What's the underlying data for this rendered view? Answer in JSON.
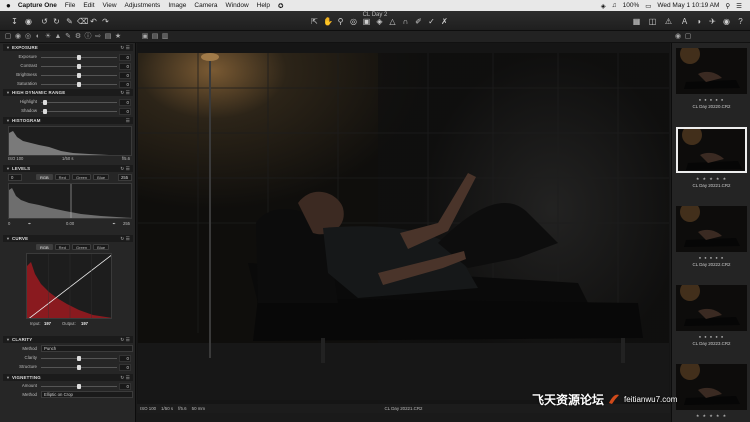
{
  "menubar": {
    "apple": "",
    "items": [
      "Capture One",
      "File",
      "Edit",
      "View",
      "Adjustments",
      "Image",
      "Camera",
      "Window",
      "Help"
    ],
    "battery": "100%",
    "clock": "Wed May 1  10:19 AM"
  },
  "toolbar": {
    "title": "CL Day 2"
  },
  "left_panel": {
    "exposure": {
      "header": "EXPOSURE",
      "rows": [
        {
          "label": "Exposure",
          "value": "0",
          "pos": 0.5
        },
        {
          "label": "Contrast",
          "value": "0",
          "pos": 0.5
        },
        {
          "label": "Brightness",
          "value": "0",
          "pos": 0.5
        },
        {
          "label": "Saturation",
          "value": "0",
          "pos": 0.5
        }
      ]
    },
    "hdr": {
      "header": "HIGH DYNAMIC RANGE",
      "rows": [
        {
          "label": "Highlight",
          "value": "0",
          "pos": 0.05
        },
        {
          "label": "Shadow",
          "value": "0",
          "pos": 0.05
        }
      ]
    },
    "histogram": {
      "header": "HISTOGRAM",
      "iso": "ISO 100",
      "shutter": "1/50 s",
      "aperture": "f/5.6"
    },
    "levels": {
      "header": "LEVELS",
      "left_value": "0",
      "channels": [
        "RGB",
        "Red",
        "Green",
        "Blue"
      ],
      "right_value": "255",
      "bottom_left": "0",
      "bottom_mid": "0.00",
      "bottom_right": "255"
    },
    "curve": {
      "header": "CURVE",
      "channels": [
        "RGB",
        "Red",
        "Green",
        "Blue"
      ],
      "input_label": "Input:",
      "input_value": "197",
      "output_label": "Output:",
      "output_value": "197"
    },
    "clarity": {
      "header": "CLARITY",
      "method_label": "Method",
      "method_value": "Punch",
      "rows": [
        {
          "label": "Clarity",
          "value": "0",
          "pos": 0.5
        },
        {
          "label": "Structure",
          "value": "0",
          "pos": 0.5
        }
      ]
    },
    "vignetting": {
      "header": "VIGNETTING",
      "rows": [
        {
          "label": "Amount",
          "value": "0",
          "pos": 0.5
        }
      ],
      "method_label": "Method",
      "method_value": "Elliptic on Crop"
    }
  },
  "viewer": {
    "status_iso": "ISO 100",
    "status_shutter": "1/50 s",
    "status_aperture": "f/5.6",
    "status_focal": "50 mm",
    "filename": "CL Day 20221.CR2"
  },
  "browser": {
    "thumbs": [
      {
        "caption": "CL Day 20220.CR2",
        "stars": "● ● ● ● ●",
        "selected": false
      },
      {
        "caption": "CL Day 20221.CR2",
        "stars": "★ ★ ★ ★ ★",
        "selected": true
      },
      {
        "caption": "CL Day 20222.CR2",
        "stars": "● ● ● ● ●",
        "selected": false
      },
      {
        "caption": "CL Day 20223.CR2",
        "stars": "● ● ● ● ●",
        "selected": false
      },
      {
        "caption": "",
        "stars": "★ ★ ★ ★ ★",
        "selected": false
      }
    ]
  },
  "watermark": {
    "cn": "飞天资源论坛",
    "domain": "feitianwu7.com"
  }
}
